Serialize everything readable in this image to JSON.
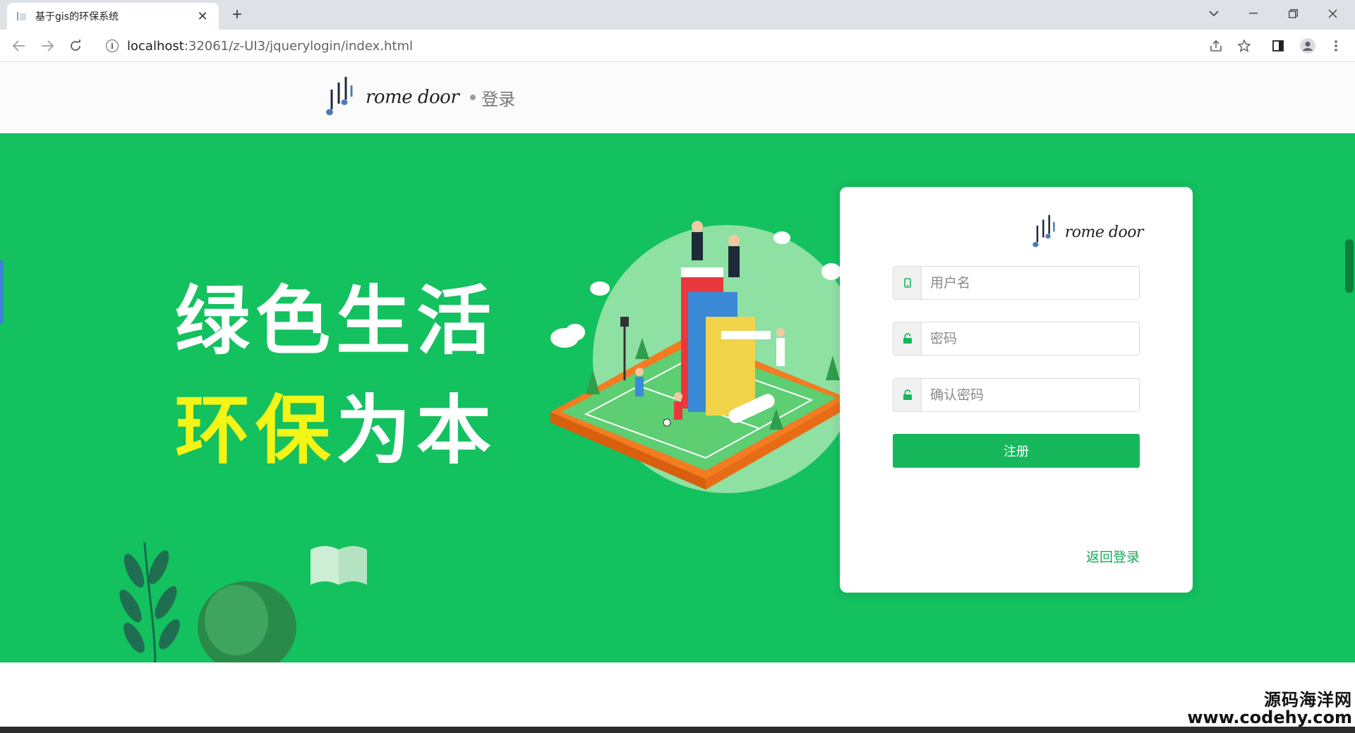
{
  "browser": {
    "tab_title": "基于gis的环保系统",
    "tab_close": "✕",
    "new_tab": "+",
    "url_host": "localhost",
    "url_path": ":32061/z-UI3/jquerylogin/index.html"
  },
  "header": {
    "brand_name": "rome door",
    "login_label": "登录"
  },
  "hero": {
    "slogan_line1": "绿色生活",
    "slogan_line2_yellow": "环保",
    "slogan_line2_white": "为本"
  },
  "form": {
    "brand_name": "rome door",
    "username_placeholder": "用户名",
    "password_placeholder": "密码",
    "confirm_placeholder": "确认密码",
    "submit_label": "注册",
    "back_link": "返回登录"
  },
  "watermark": {
    "line1": "源码海洋网",
    "line2": "www.codehy.com"
  },
  "colors": {
    "hero_green": "#13c15f",
    "button_green": "#17b75c",
    "link_green": "#19a85a",
    "slogan_yellow": "#f4f417"
  }
}
